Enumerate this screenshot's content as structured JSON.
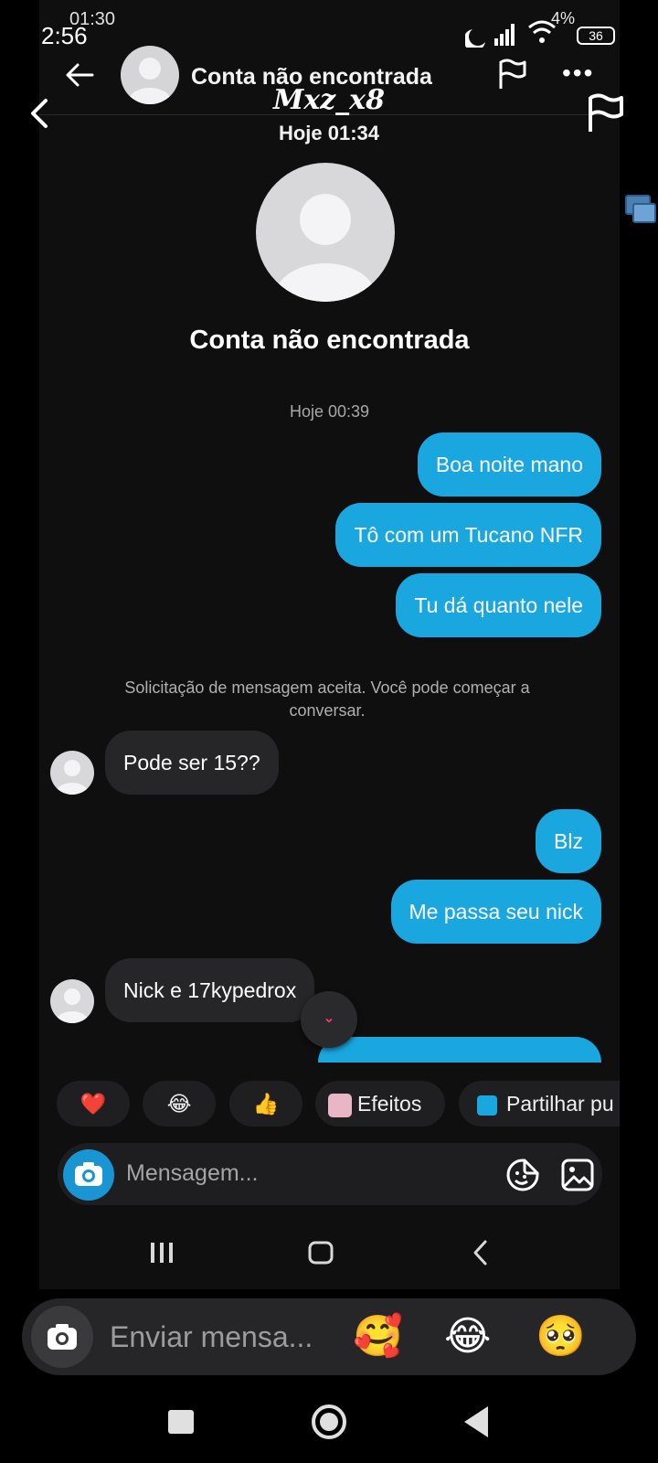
{
  "outer": {
    "username": "Mxz_x8",
    "time": "Hoje 01:34",
    "composer_placeholder": "Enviar mensa...",
    "emojis": [
      "🥰",
      "😂",
      "🥺"
    ]
  },
  "status": {
    "big_time": "2:56",
    "small_time": "01:30",
    "battery_pct": "4%",
    "battery_level": "36"
  },
  "header": {
    "title": "Conta não encontrada"
  },
  "profile": {
    "name": "Conta não encontrada"
  },
  "conversation": {
    "date_label": "Hoje 00:39",
    "system_message": "Solicitação de mensagem aceita. Você pode começar a conversar.",
    "messages": [
      {
        "dir": "out",
        "text": "Boa noite mano"
      },
      {
        "dir": "out",
        "text": "Tô com um Tucano NFR"
      },
      {
        "dir": "out",
        "text": "Tu dá quanto nele"
      },
      {
        "dir": "in",
        "text": "Pode ser 15??"
      },
      {
        "dir": "out",
        "text": "Blz"
      },
      {
        "dir": "out",
        "text": "Me passa seu nick"
      },
      {
        "dir": "in",
        "text": "Nick e 17kypedrox"
      }
    ]
  },
  "quick_reactions": {
    "heart": "❤️",
    "laugh": "😂",
    "thumbs": "👍",
    "effects_label": "Efeitos",
    "share_label": "Partilhar pu"
  },
  "composer": {
    "placeholder": "Mensagem..."
  },
  "colors": {
    "outgoing_bubble": "#1aa6de",
    "incoming_bubble": "#262628",
    "background": "#0f0f10",
    "camera_button": "#1a95d4"
  }
}
